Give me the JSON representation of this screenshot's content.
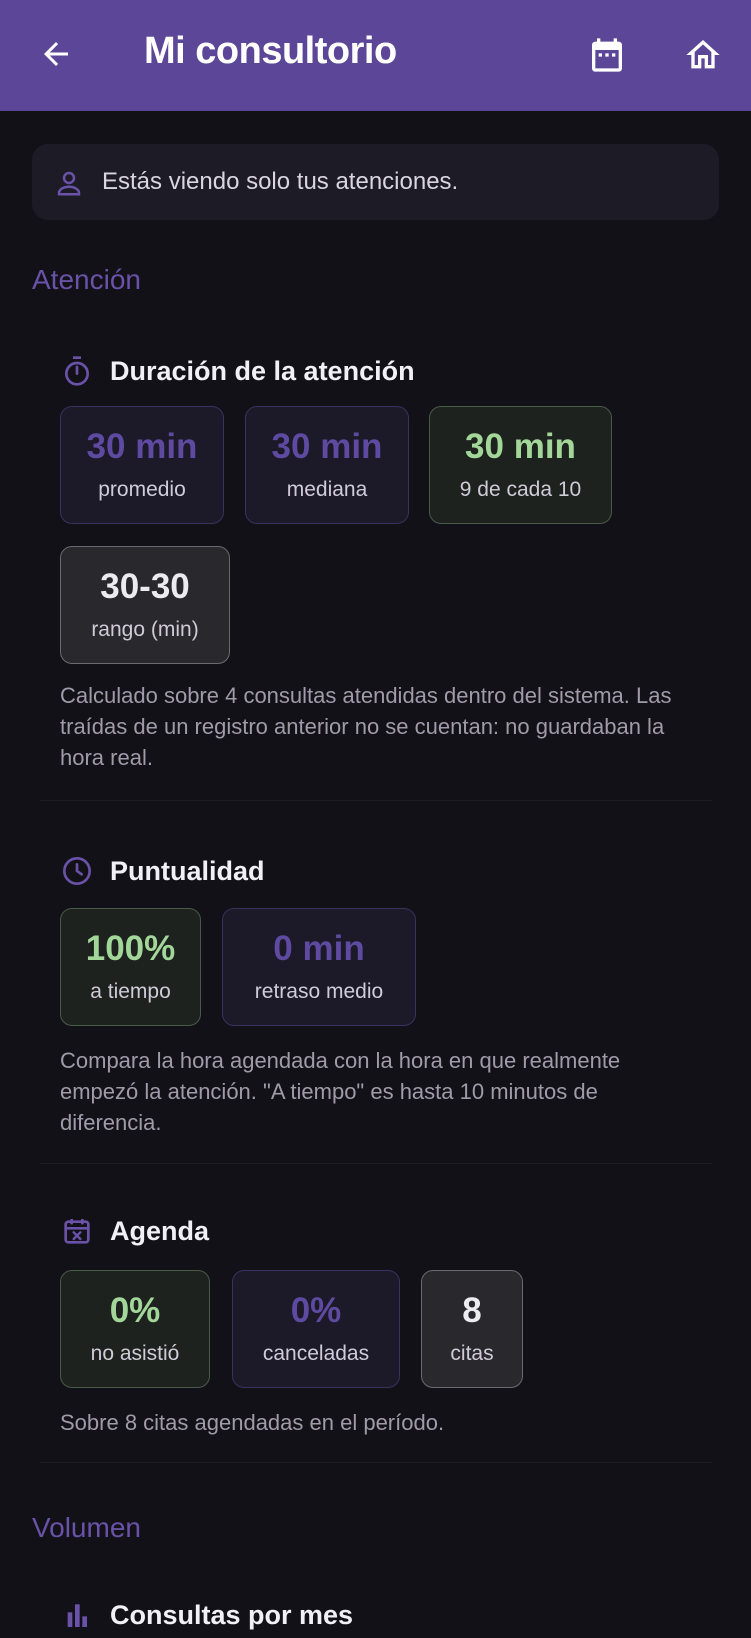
{
  "appbar": {
    "title": "Mi consultorio",
    "back_icon": "arrow-left-icon",
    "calendar_icon": "calendar-icon",
    "home_icon": "home-icon"
  },
  "notice": {
    "icon": "person-icon",
    "text": "Estás viendo solo tus atenciones."
  },
  "sections": {
    "atencion": "Atención",
    "volumen": "Volumen"
  },
  "duracion": {
    "title": "Duración de la atención",
    "icon": "stopwatch-icon",
    "tiles": [
      {
        "value": "30 min",
        "label": "promedio"
      },
      {
        "value": "30 min",
        "label": "mediana"
      },
      {
        "value": "30 min",
        "label": "9 de cada 10"
      },
      {
        "value": "30-30",
        "label": "rango (min)"
      }
    ],
    "note": "Calculado sobre 4 consultas atendidas dentro del sistema. Las traídas de un registro anterior no se cuentan: no guardaban la hora real."
  },
  "puntualidad": {
    "title": "Puntualidad",
    "icon": "clock-icon",
    "tiles": [
      {
        "value": "100%",
        "label": "a tiempo"
      },
      {
        "value": "0 min",
        "label": "retraso medio"
      }
    ],
    "note": "Compara la hora agendada con la hora en que realmente empezó la atención. \"A tiempo\" es hasta 10 minutos de diferencia."
  },
  "agenda": {
    "title": "Agenda",
    "icon": "calendar-x-icon",
    "tiles": [
      {
        "value": "0%",
        "label": "no asistió"
      },
      {
        "value": "0%",
        "label": "canceladas"
      },
      {
        "value": "8",
        "label": "citas"
      }
    ],
    "note": "Sobre 8 citas agendadas en el período."
  },
  "consultas": {
    "title": "Consultas por mes",
    "icon": "bar-chart-icon"
  },
  "colors": {
    "appbar": "#5c4697",
    "accent_purple": "#6a52a8",
    "accent_green": "#a3d79a",
    "background": "#131118"
  }
}
